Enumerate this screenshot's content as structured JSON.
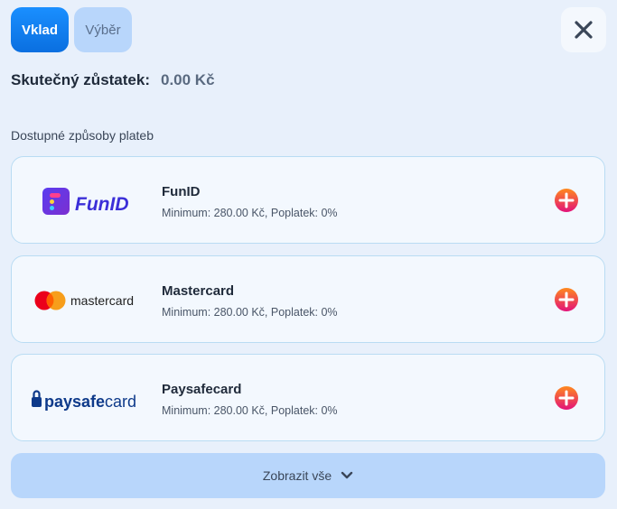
{
  "tabs": {
    "deposit": "Vklad",
    "withdraw": "Výběr"
  },
  "balance": {
    "label": "Skutečný zůstatek:",
    "value": "0.00 Kč"
  },
  "section_label": "Dostupné způsoby plateb",
  "methods": [
    {
      "name": "FunID",
      "info": "Minimum: 280.00 Kč, Poplatek: 0%",
      "logo_text": "FunID"
    },
    {
      "name": "Mastercard",
      "info": "Minimum: 280.00 Kč, Poplatek: 0%",
      "logo_text": "mastercard"
    },
    {
      "name": "Paysafecard",
      "info": "Minimum: 280.00 Kč, Poplatek: 0%",
      "logo_text_a": "paysafe",
      "logo_text_b": "card"
    }
  ],
  "show_all": "Zobrazit vše",
  "colors": {
    "accent": "#0a6fe0",
    "card_border": "#b9dcf3",
    "add_gradient_top": "#ff8a1e",
    "add_gradient_bottom": "#e2127a"
  },
  "icons": {
    "close": "close-icon",
    "add": "plus-circle-icon",
    "chevron": "chevron-down-icon"
  }
}
